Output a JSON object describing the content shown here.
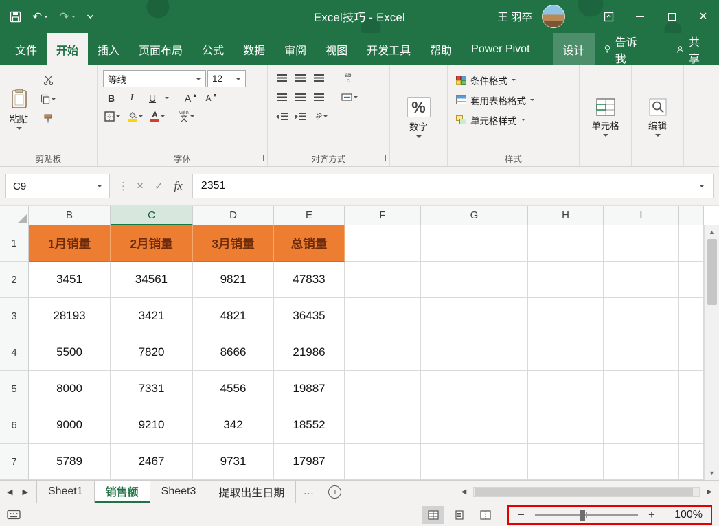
{
  "title_bar": {
    "title": "Excel技巧 - Excel",
    "user_name": "王 羽卒"
  },
  "ribbon": {
    "tabs": [
      "文件",
      "开始",
      "插入",
      "页面布局",
      "公式",
      "数据",
      "审阅",
      "视图",
      "开发工具",
      "帮助",
      "Power Pivot",
      "设计"
    ],
    "active_tab": "开始",
    "tell_me": "告诉我",
    "share": "共享",
    "clipboard": {
      "label": "剪贴板",
      "paste": "粘贴"
    },
    "font": {
      "label": "字体",
      "font_name": "等线",
      "font_size": "12",
      "bold": "B",
      "italic": "I",
      "underline": "U",
      "phonetic_py": "wén",
      "phonetic_char": "文",
      "color_letter": "A"
    },
    "alignment": {
      "label": "对齐方式",
      "wrap_top": "ab",
      "wrap_bottom": "c",
      "orient": "ab"
    },
    "number": {
      "label": "数字",
      "percent": "%"
    },
    "styles": {
      "label": "样式",
      "conditional": "条件格式",
      "format_table": "套用表格格式",
      "cell_styles": "单元格样式"
    },
    "cells": {
      "label": "单元格"
    },
    "editing": {
      "label": "编辑"
    }
  },
  "formula_bar": {
    "name_box": "C9",
    "fx": "fx",
    "value": "2351"
  },
  "grid": {
    "columns": [
      "B",
      "C",
      "D",
      "E",
      "F",
      "G",
      "H",
      "I"
    ],
    "selected_column": "C",
    "row_numbers": [
      "1",
      "2",
      "3",
      "4",
      "5",
      "6",
      "7"
    ],
    "table": {
      "headers": [
        "1月销量",
        "2月销量",
        "3月销量",
        "总销量"
      ],
      "data": [
        [
          "3451",
          "34561",
          "9821",
          "47833"
        ],
        [
          "28193",
          "3421",
          "4821",
          "36435"
        ],
        [
          "5500",
          "7820",
          "8666",
          "21986"
        ],
        [
          "8000",
          "7331",
          "4556",
          "19887"
        ],
        [
          "9000",
          "9210",
          "342",
          "18552"
        ],
        [
          "5789",
          "2467",
          "9731",
          "17987"
        ]
      ]
    }
  },
  "sheet_bar": {
    "tabs": [
      "Sheet1",
      "销售额",
      "Sheet3",
      "提取出生日期"
    ],
    "active_tab": "销售额",
    "overflow": "…"
  },
  "status_bar": {
    "zoom_out": "−",
    "zoom_in": "+",
    "zoom": "100%"
  },
  "colors": {
    "titlebar_green": "#217346",
    "table_header_orange": "#ED7D31",
    "table_header_text": "#6F2C0B",
    "annotation_red": "#E50000"
  }
}
